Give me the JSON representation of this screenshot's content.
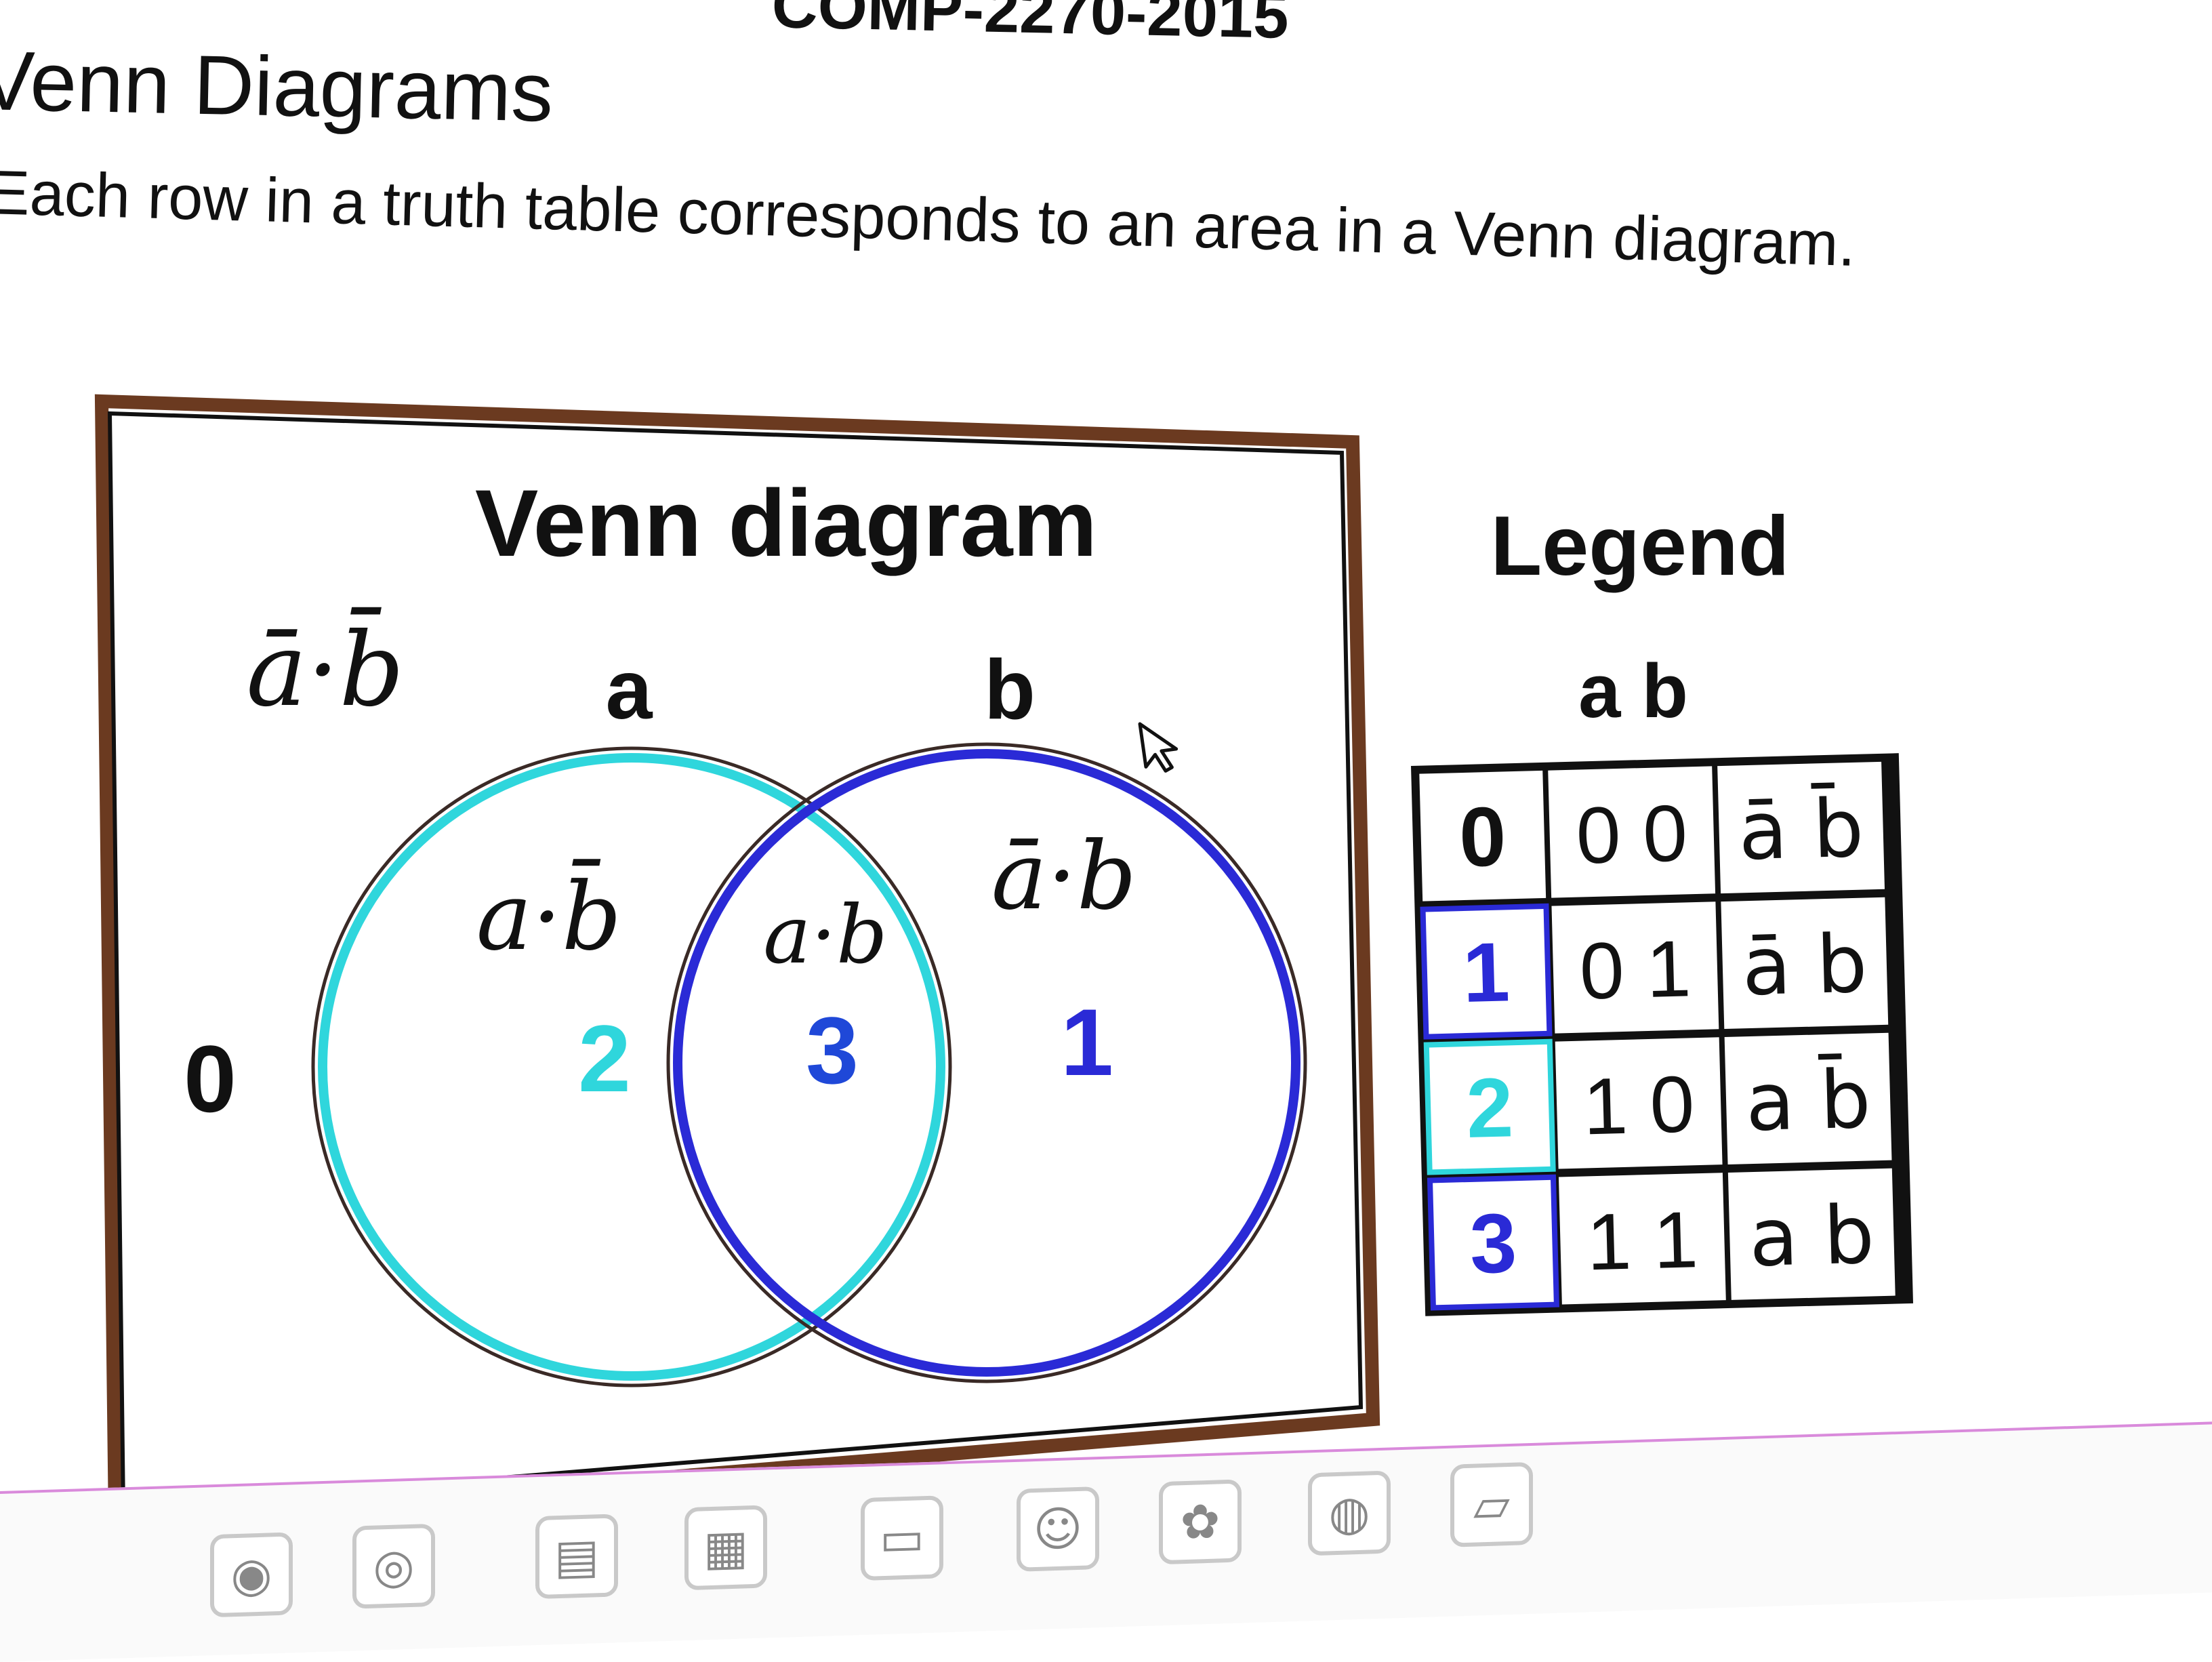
{
  "page": {
    "course_heading": "COMP-2270-2015",
    "section_title": "Venn Diagrams",
    "intro": "Each row in a truth table corresponds to an area in a Venn diagram."
  },
  "venn": {
    "title": "Venn diagram",
    "set_a_label": "a",
    "set_b_label": "b",
    "outside_region": "0",
    "region_a_only": "2",
    "region_both": "3",
    "region_b_only": "1",
    "notes": {
      "outside": "ā·b̄",
      "a_only": "a·b̄",
      "both": "a·b",
      "b_only": "ā·b"
    },
    "colors": {
      "set_a": "#2fd6dc",
      "set_b": "#2a2ad6",
      "frame": "#7a3a1c",
      "ink": "#111111"
    }
  },
  "legend": {
    "title": "Legend",
    "header": "a b",
    "rows": [
      {
        "area": "0",
        "bits": "0 0",
        "term": "ā b̄"
      },
      {
        "area": "1",
        "bits": "0 1",
        "term": "ā b"
      },
      {
        "area": "2",
        "bits": "1 0",
        "term": "a b̄"
      },
      {
        "area": "3",
        "bits": "1 1",
        "term": "a b"
      }
    ]
  },
  "taskbar": {
    "icons": [
      "chrome-icon",
      "firefox-icon",
      "files-icon",
      "notes-icon",
      "terminal-icon",
      "user-icon",
      "settings-icon",
      "photos-icon",
      "drive-icon"
    ]
  }
}
